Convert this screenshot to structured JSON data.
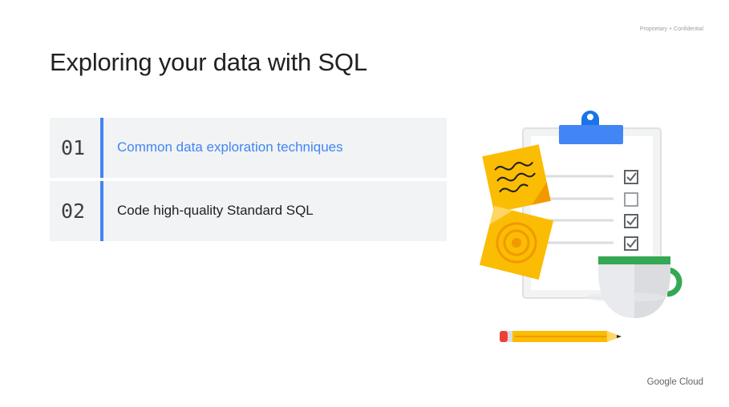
{
  "header": {
    "confidential": "Proprietary + Confidential"
  },
  "slide": {
    "title": "Exploring your data with SQL"
  },
  "agenda": {
    "items": [
      {
        "number": "01",
        "label": "Common data exploration techniques",
        "active": true
      },
      {
        "number": "02",
        "label": "Code high-quality Standard SQL",
        "active": false
      }
    ]
  },
  "illustration": {
    "icons": [
      "clipboard-icon",
      "sticky-note-icon",
      "target-note-icon",
      "coffee-cup-icon",
      "pencil-icon"
    ],
    "colors": {
      "blue": "#1a73e8",
      "yellow": "#fbbc04",
      "green": "#34a853",
      "red": "#ea4335"
    }
  },
  "footer": {
    "logo": "Google Cloud"
  },
  "colors": {
    "accent": "#4285f4",
    "row_background": "#f1f3f4"
  }
}
